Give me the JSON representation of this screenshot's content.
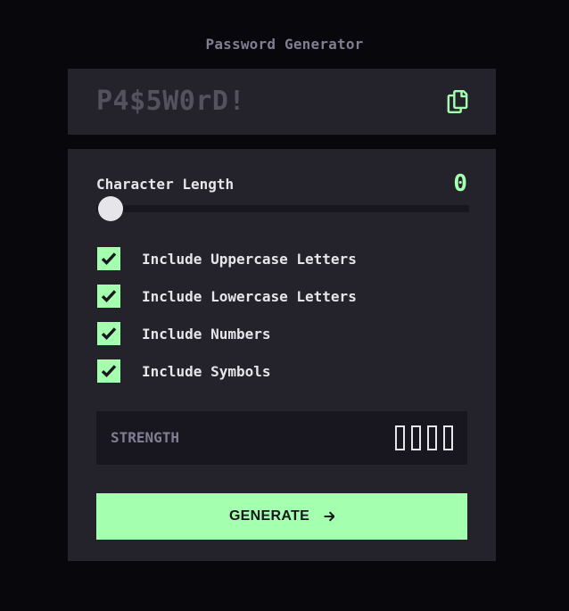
{
  "app": {
    "title": "Password Generator"
  },
  "output": {
    "password_placeholder": "P4$5W0rD!",
    "copy_icon": "copy-icon"
  },
  "length": {
    "label": "Character Length",
    "value": "0",
    "slider_fraction": 0
  },
  "options": [
    {
      "label": "Include Uppercase Letters",
      "checked": true
    },
    {
      "label": "Include Lowercase Letters",
      "checked": true
    },
    {
      "label": "Include Numbers",
      "checked": true
    },
    {
      "label": "Include Symbols",
      "checked": true
    }
  ],
  "strength": {
    "label": "STRENGTH",
    "level_filled": 0,
    "bar_count": 4
  },
  "generate": {
    "label": "GENERATE",
    "icon": "arrow-right-icon"
  },
  "colors": {
    "background": "#08070b",
    "panel": "#24232c",
    "accent": "#a4ffaf",
    "muted": "#817d92",
    "text": "#e6e5ea",
    "dark": "#18171f"
  }
}
